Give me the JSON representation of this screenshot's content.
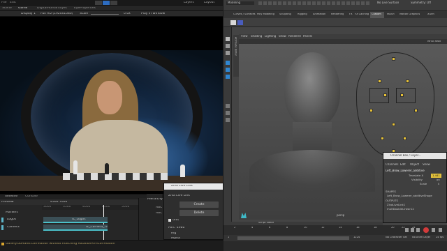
{
  "unity": {
    "menu_items": [
      "File",
      "Edit",
      "Assets",
      "GameObject",
      "Component",
      "Window",
      "Help"
    ],
    "layers_label": "Layers",
    "layout_label": "Layout",
    "tabs": [
      "Scene",
      "Game",
      "DigitalHuman.Eyes",
      "EyeProperties"
    ],
    "game_bar": {
      "display": "Display 1",
      "resolution": "Full HD (1920x1080)",
      "scale_label": "Scale",
      "scale_value": "0.6x",
      "play_mode": "Play In Window"
    },
    "timeline": {
      "tabs": [
        "Timeline",
        "Console"
      ],
      "preview_label": "Preview",
      "frame_counter": "4506 7000",
      "markers_label": "Markers",
      "tracks": [
        {
          "name": "Logos",
          "clip": "TL_Logos"
        },
        {
          "name": "Camera",
          "clip": "TL_Camera_TF"
        }
      ],
      "ruler_labels": [
        "3000",
        "3500",
        "4000",
        "4500",
        "5000",
        "5500"
      ]
    },
    "hierarchy": {
      "tab": "Hierarchy",
      "items": [
        "ABC",
        "ABC"
      ]
    },
    "status": "Gallery.GoHand.Correlation without matching RotationArmCorrelation"
  },
  "zivaPopup": {
    "title": "Ziva Live Link",
    "header": "Ziva Live Link",
    "create_label": "Create",
    "delete_label": "Delete",
    "unit_label": "Unit",
    "port_label": "Port: 4986",
    "rows": [
      "Rig",
      "Alpha"
    ]
  },
  "maya": {
    "workspace": "Modeling",
    "no_live_surface": "No Live Surface",
    "symmetry": "Symmetry: Off",
    "shelf_tabs": [
      "Curves / Surfaces",
      "Poly Modeling",
      "Sculpting",
      "Rigging",
      "Animation",
      "Rendering",
      "FX",
      "FX Caching",
      "Custom",
      "MASH",
      "Motion Graphics",
      "XGen"
    ],
    "viewport_menu": [
      "View",
      "Shading",
      "Lighting",
      "Show",
      "Renderer",
      "Panels"
    ],
    "side_tab": "Attribute Editor",
    "face_control_label": "MFSB head",
    "persp_label": "persp",
    "script_editor": "Script Editor",
    "channel_box": {
      "title": "Channel Box / Layer...",
      "menu": [
        "Channels",
        "Edit",
        "Object",
        "Show"
      ],
      "node_name": "Left_Brow_Lowerer_additive",
      "translate_x_label": "Translate X",
      "translate_x_value": "1.441",
      "visibility_label": "Visibility",
      "visibility_value": "on",
      "scale_label": "Scale",
      "scale_value": "0",
      "shapes_label": "SHAPES",
      "shape_name": "Left_Brow_Lowerer_additiveShape",
      "outputs_label": "OUTPUTS",
      "outputs": [
        "ZivaLiveLink1",
        "multDoubleLinear12"
      ]
    },
    "timeline_numbers": [
      "2",
      "4",
      "6",
      "8",
      "10",
      "12",
      "14",
      "16",
      "18",
      "20",
      "22",
      "24"
    ],
    "range_start": "1",
    "range_end": "1224",
    "char_set": "No Character Set",
    "anim_layer": "No Anim Layer",
    "fps": "24 fps"
  }
}
